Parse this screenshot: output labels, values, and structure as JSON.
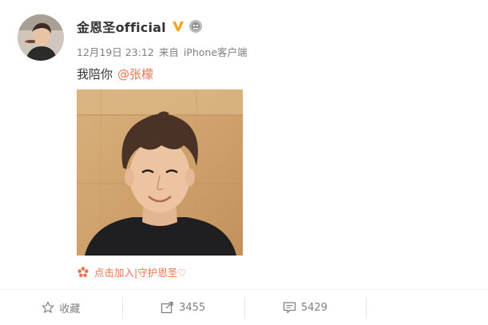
{
  "user": {
    "name": "金恩圣official",
    "verified_icon": "verified-v-icon",
    "member_icon": "member-badge-icon"
  },
  "meta": {
    "time": "12月19日 23:12",
    "from_label": "来自",
    "source": "iPhone客户端"
  },
  "post": {
    "text": "我陪你",
    "mention": "@张檬"
  },
  "footer_link": {
    "icon": "flower-icon",
    "text": "点击加入|守护恩圣♡"
  },
  "actions": {
    "favorite_label": "收藏",
    "repost_count": "3455",
    "comment_count": "5429"
  },
  "colors": {
    "accent": "#eb7350",
    "verified": "#f5a623",
    "meta_text": "#808080"
  }
}
